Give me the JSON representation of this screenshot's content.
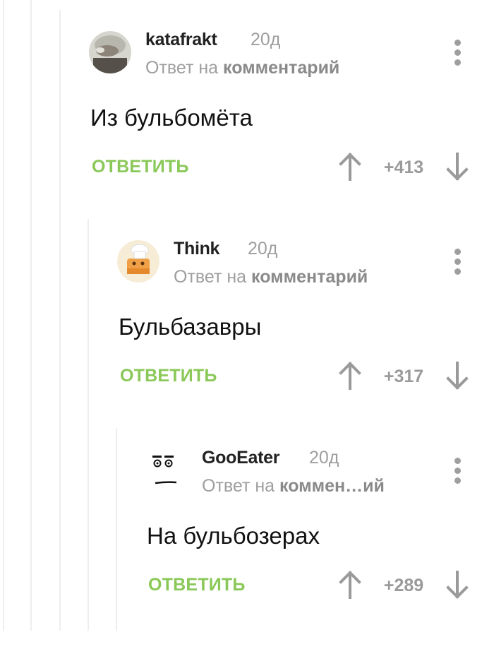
{
  "comments": [
    {
      "username": "katafrakt",
      "time": "20д",
      "reply_prefix": "Ответ на",
      "reply_target": "комментарий",
      "text": "Из бульбомёта",
      "reply_label": "ОТВЕТИТЬ",
      "score": "+413"
    },
    {
      "username": "Think",
      "time": "20д",
      "reply_prefix": "Ответ на",
      "reply_target": "комментарий",
      "text": "Бульбазавры",
      "reply_label": "ОТВЕТИТЬ",
      "score": "+317"
    },
    {
      "username": "GooEater",
      "time": "20д",
      "reply_prefix": "Ответ на",
      "reply_target": "коммен…ий",
      "text": "На бульбозерах",
      "reply_label": "ОТВЕТИТЬ",
      "score": "+289"
    }
  ],
  "colors": {
    "accent_green": "#8ac858",
    "muted_gray": "#9e9e9e",
    "thread_line": "#eeeeee"
  },
  "icons": [
    "user-avatar",
    "arrow-up-icon",
    "arrow-down-icon",
    "more-vertical-icon"
  ]
}
